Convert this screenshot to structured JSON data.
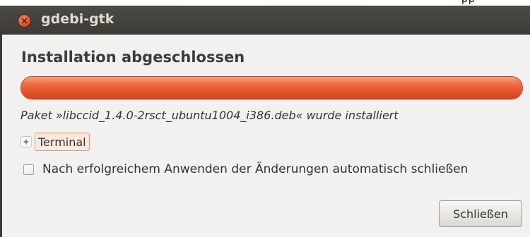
{
  "top_strip": {
    "text": "pp"
  },
  "window": {
    "title": "gdebi-gtk",
    "close_icon": "close-icon"
  },
  "dialog": {
    "heading": "Installation abgeschlossen",
    "progress_fraction": 1.0,
    "accent_color": "#e45a33",
    "status": "Paket »libccid_1.4.0-2rsct_ubuntu1004_i386.deb« wurde installiert",
    "expander": {
      "toggle_icon": "plus-icon",
      "label": "Terminal",
      "expanded": false
    },
    "auto_close": {
      "label": "Nach erfolgreichem Anwenden der Änderungen automatisch schließen",
      "checked": false
    },
    "close_button_label": "Schließen"
  }
}
